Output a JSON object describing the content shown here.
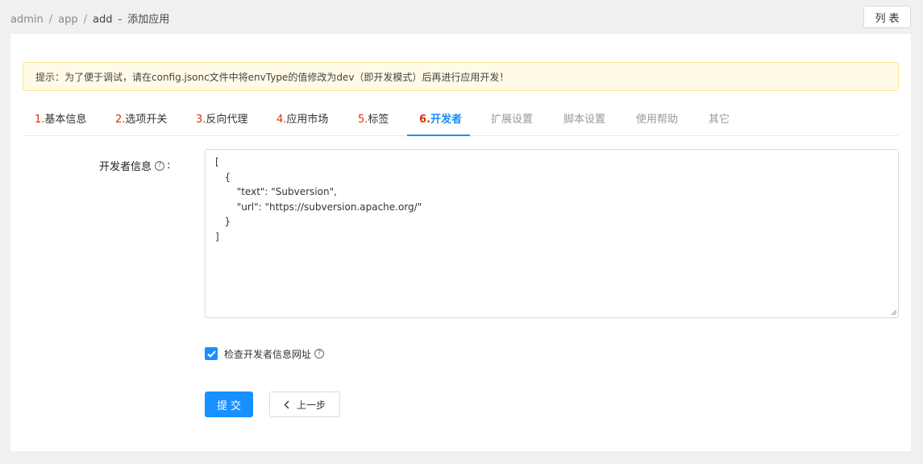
{
  "breadcrumb": {
    "items": [
      "admin",
      "app",
      "add"
    ],
    "separator": "/",
    "dash": "-",
    "current": "添加应用"
  },
  "header": {
    "list_button": "列表"
  },
  "notice": {
    "text": "提示：为了便于调试，请在config.jsonc文件中将envType的值修改为dev（即开发模式）后再进行应用开发！"
  },
  "tabs": [
    {
      "num": "1.",
      "label": "基本信息"
    },
    {
      "num": "2.",
      "label": "选项开关"
    },
    {
      "num": "3.",
      "label": "反向代理"
    },
    {
      "num": "4.",
      "label": "应用市场"
    },
    {
      "num": "5.",
      "label": "标签"
    },
    {
      "num": "6.",
      "label": "开发者"
    },
    {
      "num": "",
      "label": "扩展设置"
    },
    {
      "num": "",
      "label": "脚本设置"
    },
    {
      "num": "",
      "label": "使用帮助"
    },
    {
      "num": "",
      "label": "其它"
    }
  ],
  "active_tab": 5,
  "form": {
    "developer_label": "开发者信息",
    "colon": ":",
    "developer_value": "[\n   {\n       \"text\": \"Subversion\",\n       \"url\": \"https://subversion.apache.org/\"\n   }\n]",
    "check_label": "检查开发者信息网址",
    "check_checked": true
  },
  "buttons": {
    "submit": "提交",
    "prev": "上一步"
  },
  "colors": {
    "primary": "#1890ff",
    "tab_number": "#e02d00",
    "notice_bg": "#fffbe6",
    "notice_border": "#ffe58f",
    "page_bg": "#f0f0f0"
  },
  "icons": {
    "help": "question-circle-icon",
    "check": "check-icon",
    "prev": "chevron-left-icon",
    "resize": "resize-handle-icon"
  }
}
